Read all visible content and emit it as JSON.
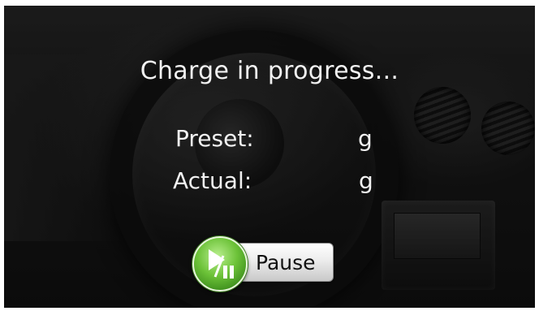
{
  "status": {
    "title": "Charge in progress..."
  },
  "preset": {
    "label": "Preset:",
    "value": "",
    "unit": "g"
  },
  "actual": {
    "label": "Actual:",
    "value": "",
    "unit": "g"
  },
  "pause_button": {
    "label": "Pause",
    "icon": "play-pause-icon",
    "color": "#6cc238"
  }
}
